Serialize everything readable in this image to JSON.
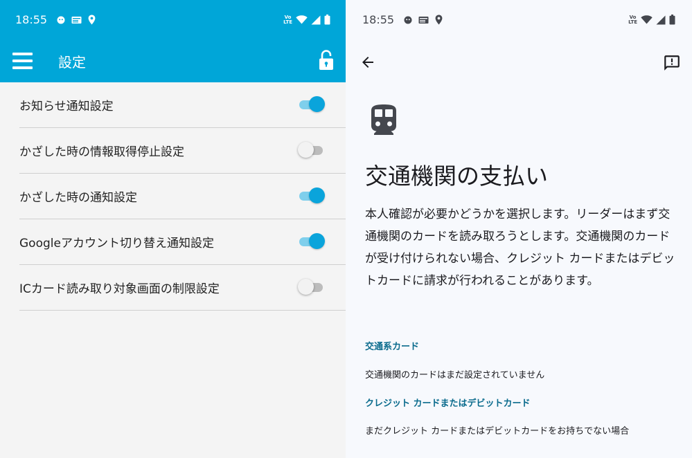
{
  "left": {
    "status_bar": {
      "time": "18:55"
    },
    "app_bar": {
      "title": "設定"
    },
    "settings": [
      {
        "label": "お知らせ通知設定",
        "enabled": true
      },
      {
        "label": "かざした時の情報取得停止設定",
        "enabled": false
      },
      {
        "label": "かざした時の通知設定",
        "enabled": true
      },
      {
        "label": "Googleアカウント切り替え通知設定",
        "enabled": true
      },
      {
        "label": "ICカード読み取り対象画面の制限設定",
        "enabled": false
      }
    ]
  },
  "right": {
    "status_bar": {
      "time": "18:55"
    },
    "title": "交通機関の支払い",
    "description": "本人確認が必要かどうかを選択します。リーダーはまず交通機関のカードを読み取ろうとします。交通機関のカードが受け付けられない場合、クレジット カードまたはデビットカードに請求が行われることがあります。",
    "sections": [
      {
        "header": "交通系カード",
        "text": "交通機関のカードはまだ設定されていません"
      },
      {
        "header": "クレジット カードまたはデビットカード",
        "text": "まだクレジット カードまたはデビットカードをお持ちでない場合"
      }
    ]
  },
  "icons": {
    "menu": "hamburger-menu-icon",
    "lock": "unlocked-padlock-icon",
    "back": "arrow-back-icon",
    "feedback": "feedback-icon",
    "train": "train-icon"
  },
  "colors": {
    "app_bar": "#00a6d8",
    "switch_on": "#0aa4db",
    "section_header": "#0a6b8d",
    "left_background": "#f4f4f4",
    "right_background": "#f7f9fd"
  }
}
